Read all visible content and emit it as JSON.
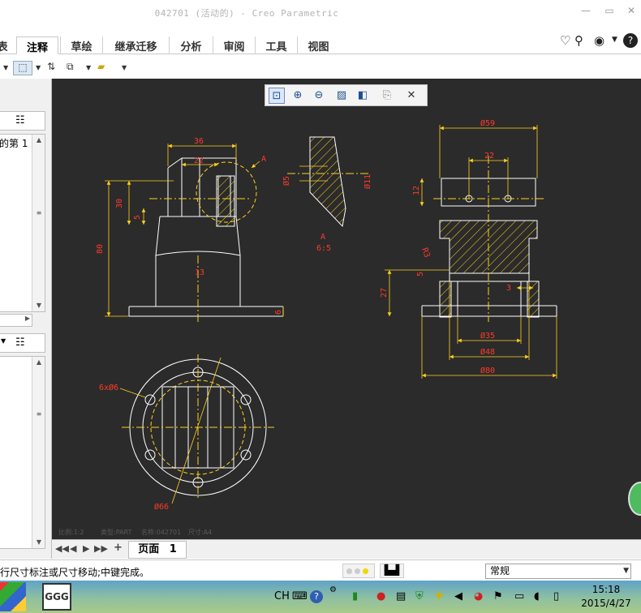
{
  "app": {
    "title": "042701 (活动的) - Creo Parametric"
  },
  "ribbon": {
    "tabs": [
      {
        "label": "表",
        "active": false
      },
      {
        "label": "注释",
        "active": true
      },
      {
        "label": "草绘",
        "active": false
      },
      {
        "label": "继承迁移",
        "active": false
      },
      {
        "label": "分析",
        "active": false
      },
      {
        "label": "审阅",
        "active": false
      },
      {
        "label": "工具",
        "active": false
      },
      {
        "label": "视图",
        "active": false
      }
    ]
  },
  "left_panel": {
    "tree_text": "的第 1"
  },
  "drawing": {
    "front_view": {
      "dims": [
        "36",
        "22",
        "30",
        "5",
        "80",
        "13",
        "6"
      ],
      "detail_label": "A"
    },
    "section_view": {
      "dims": [
        "Ø5",
        "Ø11"
      ],
      "label": "A",
      "scale": "6:5"
    },
    "side_view": {
      "dims": [
        "Ø59",
        "22",
        "12",
        "R3",
        "5",
        "27",
        "3",
        "Ø35",
        "Ø48",
        "Ø80"
      ]
    },
    "top_view": {
      "dims": [
        "6xØ6",
        "Ø66"
      ]
    },
    "footer": {
      "scale": "比例:1:2",
      "type": "类型:PART",
      "name": "名称:042701",
      "size": "尺寸:A4"
    }
  },
  "sheet_bar": {
    "sheet_label": "页面",
    "sheet_number": "1",
    "add": "+"
  },
  "status": {
    "message": "行尺寸标注或尺寸移动;中键完成。",
    "filter_value": "常规"
  },
  "taskbar": {
    "app_label": "GGG",
    "ime": "CH",
    "time": "15:18",
    "date": "2015/4/27"
  },
  "colors": {
    "canvas_bg": "#2b2b2b",
    "geometry": "#ffffff",
    "dimension": "#ffd21e",
    "dim_text": "#ff3a2a",
    "centerline": "#ffd21e"
  }
}
